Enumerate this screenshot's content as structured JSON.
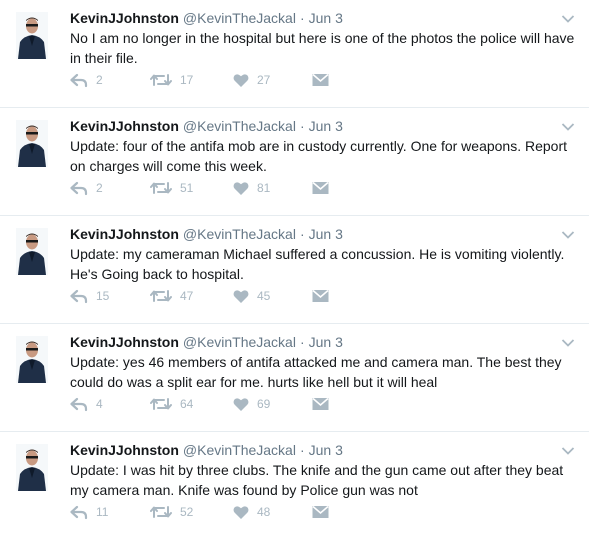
{
  "tweets": [
    {
      "name": "KevinJJohnston",
      "handle": "@KevinTheJackal",
      "separator": "·",
      "date": "Jun 3",
      "text": "No I am no longer in the hospital but here is one of the photos the police will have in their file.",
      "replies": "2",
      "retweets": "17",
      "likes": "27"
    },
    {
      "name": "KevinJJohnston",
      "handle": "@KevinTheJackal",
      "separator": "·",
      "date": "Jun 3",
      "text": "Update: four of the antifa mob are in custody currently. One for weapons. Report on charges will come this week.",
      "replies": "2",
      "retweets": "51",
      "likes": "81"
    },
    {
      "name": "KevinJJohnston",
      "handle": "@KevinTheJackal",
      "separator": "·",
      "date": "Jun 3",
      "text": "Update: my cameraman Michael suffered a concussion. He is vomiting violently. He's Going back to hospital.",
      "replies": "15",
      "retweets": "47",
      "likes": "45"
    },
    {
      "name": "KevinJJohnston",
      "handle": "@KevinTheJackal",
      "separator": "·",
      "date": "Jun 3",
      "text": "Update: yes 46 members of antifa attacked me and camera man. The best they could do was a split ear for me. hurts like hell but it will heal",
      "replies": "4",
      "retweets": "64",
      "likes": "69"
    },
    {
      "name": "KevinJJohnston",
      "handle": "@KevinTheJackal",
      "separator": "·",
      "date": "Jun 3",
      "text": "Update: I was hit by three clubs. The knife and the gun came out after they beat my camera man. Knife was found by Police gun was not",
      "replies": "11",
      "retweets": "52",
      "likes": "48"
    }
  ],
  "icons": {
    "reply": "reply-icon",
    "retweet": "retweet-icon",
    "like": "heart-icon",
    "message": "envelope-icon",
    "more": "chevron-down-icon"
  },
  "colors": {
    "icon": "#aab8c2",
    "secondary_text": "#657786",
    "divider": "#e6ecf0"
  }
}
